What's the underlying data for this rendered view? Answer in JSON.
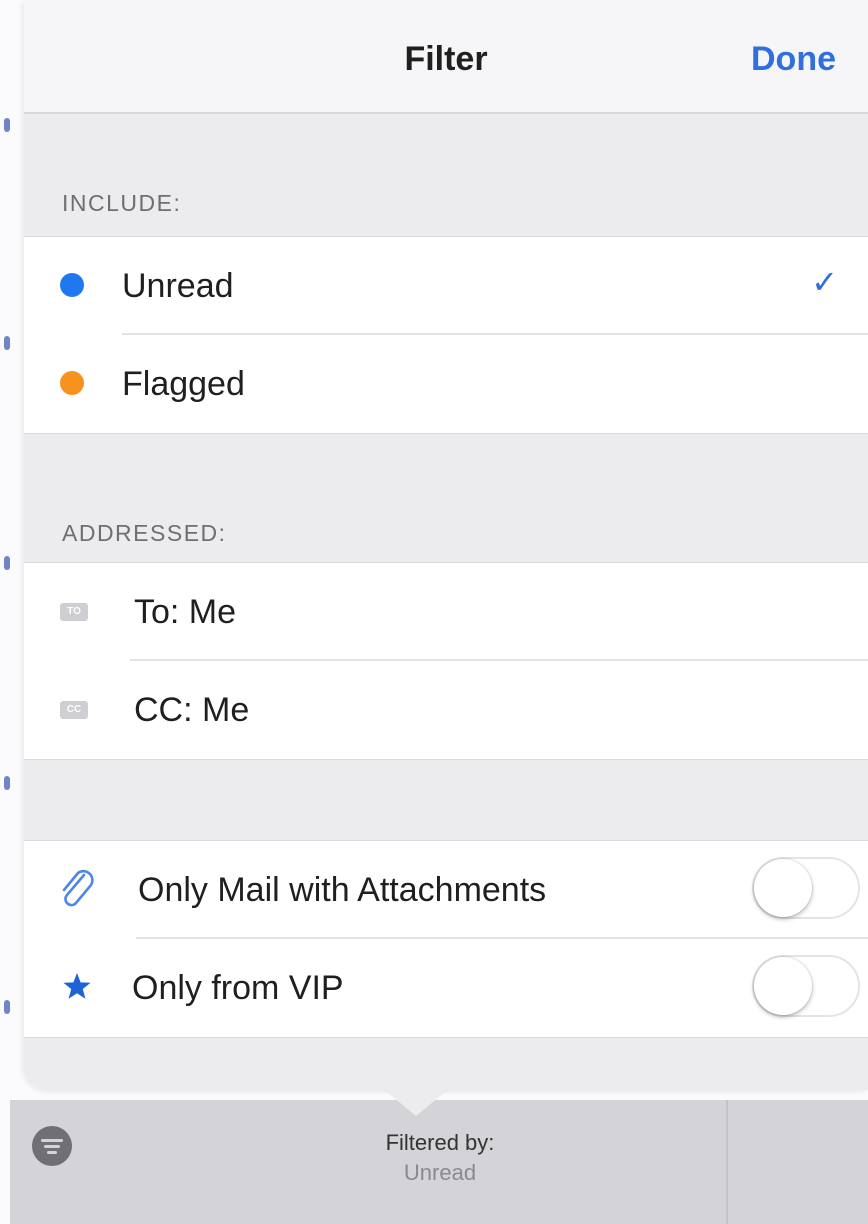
{
  "header": {
    "title": "Filter",
    "done_label": "Done"
  },
  "include": {
    "heading": "INCLUDE:",
    "items": [
      {
        "label": "Unread",
        "dot_color": "#1f78f0",
        "checked": true,
        "check": "✓"
      },
      {
        "label": "Flagged",
        "dot_color": "#f7921e",
        "checked": false
      }
    ]
  },
  "addressed": {
    "heading": "ADDRESSED:",
    "items": [
      {
        "label": "To: Me",
        "badge": "TO",
        "icon": "to-badge-icon"
      },
      {
        "label": "CC: Me",
        "badge": "CC",
        "icon": "cc-badge-icon"
      }
    ]
  },
  "options": {
    "items": [
      {
        "label": "Only Mail with Attachments",
        "icon": "paperclip-icon",
        "on": false
      },
      {
        "label": "Only from VIP",
        "icon": "star-icon",
        "on": false
      }
    ]
  },
  "toolbar": {
    "filtered_by_label": "Filtered by:",
    "filtered_value": "Unread",
    "icon": "filter-icon"
  },
  "colors": {
    "accent": "#2f6fde",
    "unread_dot": "#1f78f0",
    "flagged_dot": "#f7921e"
  }
}
